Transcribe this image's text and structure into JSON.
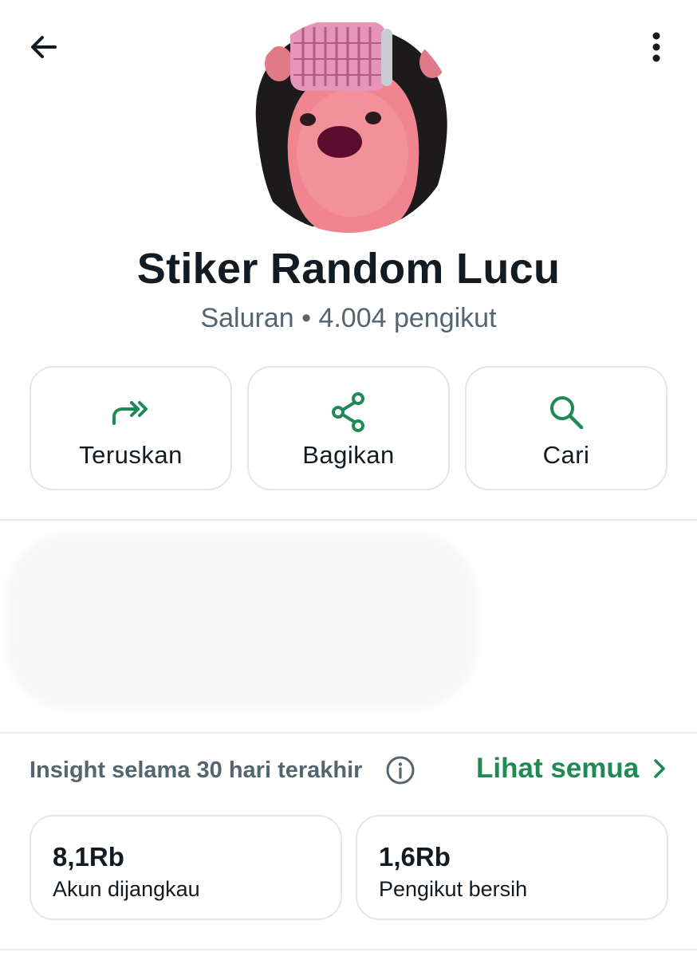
{
  "header": {
    "back_icon": "arrow-left-icon",
    "menu_icon": "more-vertical-icon"
  },
  "channel": {
    "name": "Stiker Random Lucu",
    "subtitle": "Saluran • 4.004 pengikut"
  },
  "actions": [
    {
      "label": "Teruskan",
      "icon": "forward-icon"
    },
    {
      "label": "Bagikan",
      "icon": "share-icon"
    },
    {
      "label": "Cari",
      "icon": "search-icon"
    }
  ],
  "insights": {
    "label": "Insight selama 30 hari terakhir",
    "see_all": "Lihat semua",
    "stats": [
      {
        "value": "8,1Rb",
        "caption": "Akun dijangkau"
      },
      {
        "value": "1,6Rb",
        "caption": "Pengikut bersih"
      }
    ]
  },
  "colors": {
    "accent": "#1f8a54",
    "text_primary": "#111b21",
    "text_secondary": "#54656f",
    "border": "#e4e6e8"
  }
}
